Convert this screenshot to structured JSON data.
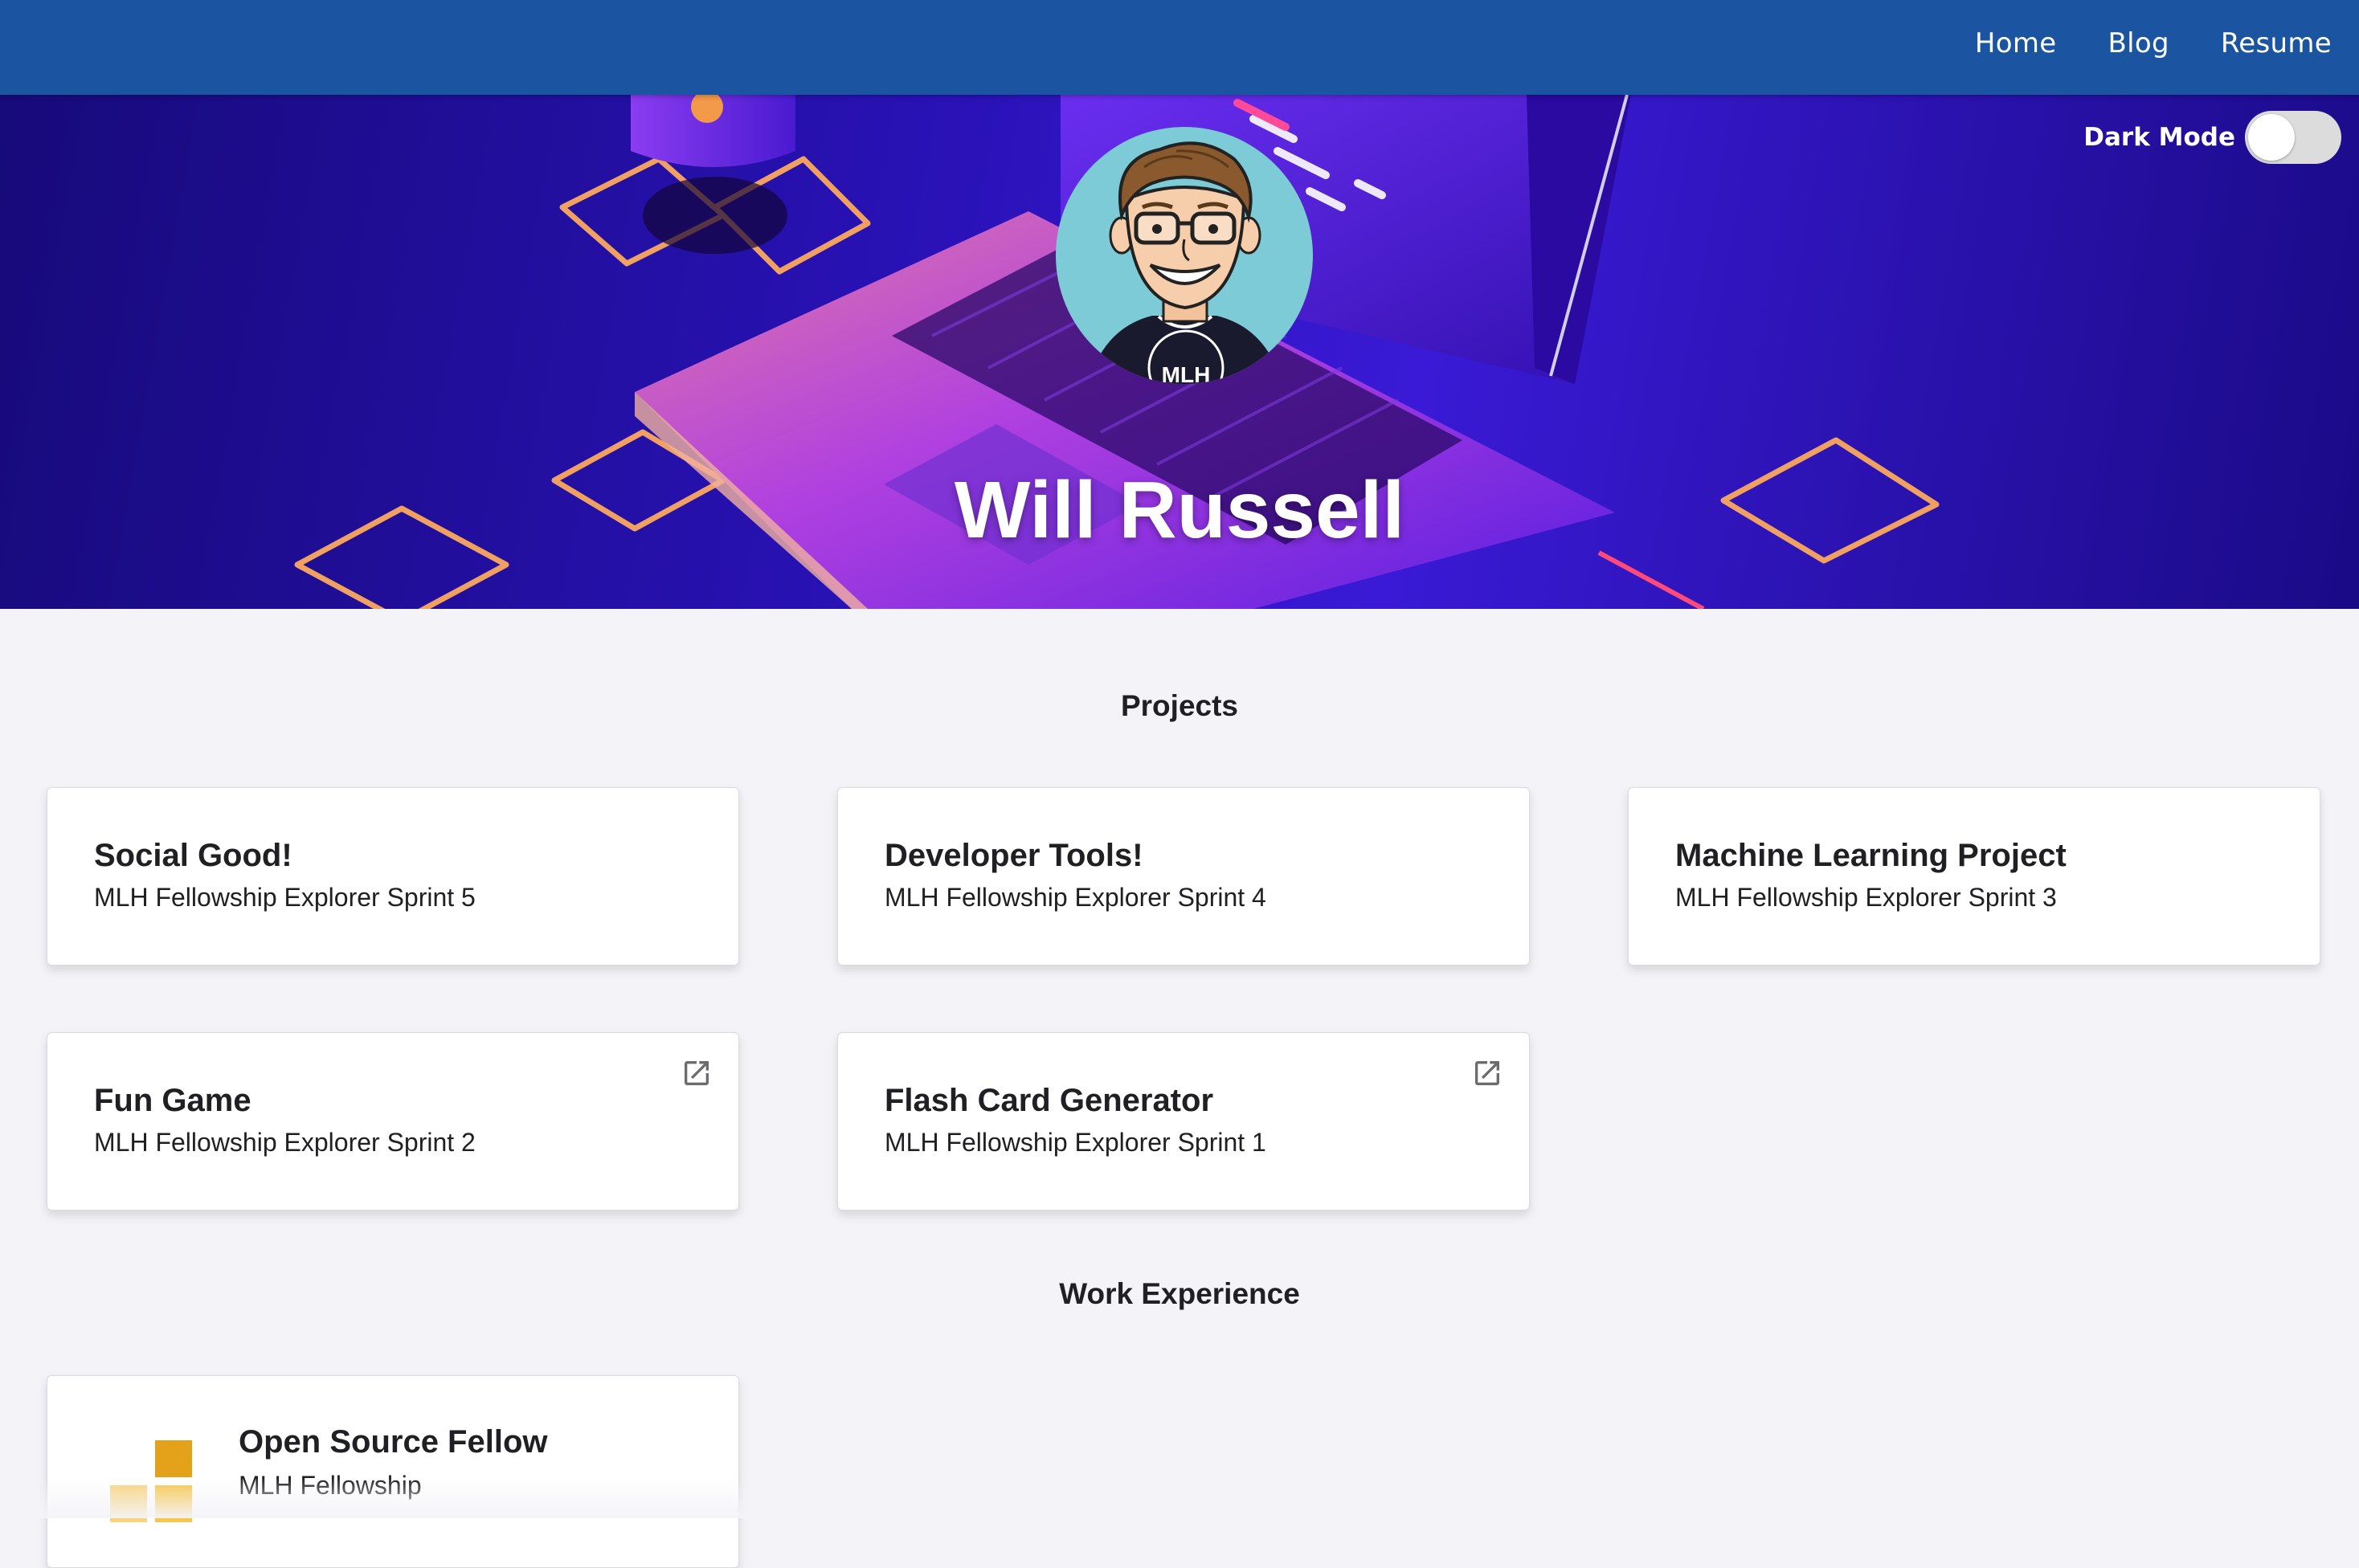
{
  "nav": {
    "links": [
      {
        "label": "Home"
      },
      {
        "label": "Blog"
      },
      {
        "label": "Resume"
      }
    ]
  },
  "hero": {
    "dark_mode_label": "Dark Mode",
    "dark_mode_on": false,
    "name": "Will Russell",
    "avatar_shirt_text": "MLH"
  },
  "projects": {
    "title": "Projects",
    "items": [
      {
        "title": "Social Good!",
        "subtitle": "MLH Fellowship Explorer Sprint 5",
        "external_link": false
      },
      {
        "title": "Developer Tools!",
        "subtitle": "MLH Fellowship Explorer Sprint 4",
        "external_link": false
      },
      {
        "title": "Machine Learning Project",
        "subtitle": "MLH Fellowship Explorer Sprint 3",
        "external_link": false
      },
      {
        "title": "Fun Game",
        "subtitle": "MLH Fellowship Explorer Sprint 2",
        "external_link": true
      },
      {
        "title": "Flash Card Generator",
        "subtitle": "MLH Fellowship Explorer Sprint 1",
        "external_link": true
      }
    ]
  },
  "work": {
    "title": "Work Experience",
    "items": [
      {
        "title": "Open Source Fellow",
        "subtitle": "MLH Fellowship",
        "logo": "mlh-fellowship-logo"
      }
    ]
  },
  "colors": {
    "navbar": "#1b54a0",
    "background": "#f4f4f8",
    "logo_gold": "#e3a21a",
    "logo_light": "#f7c54a"
  }
}
